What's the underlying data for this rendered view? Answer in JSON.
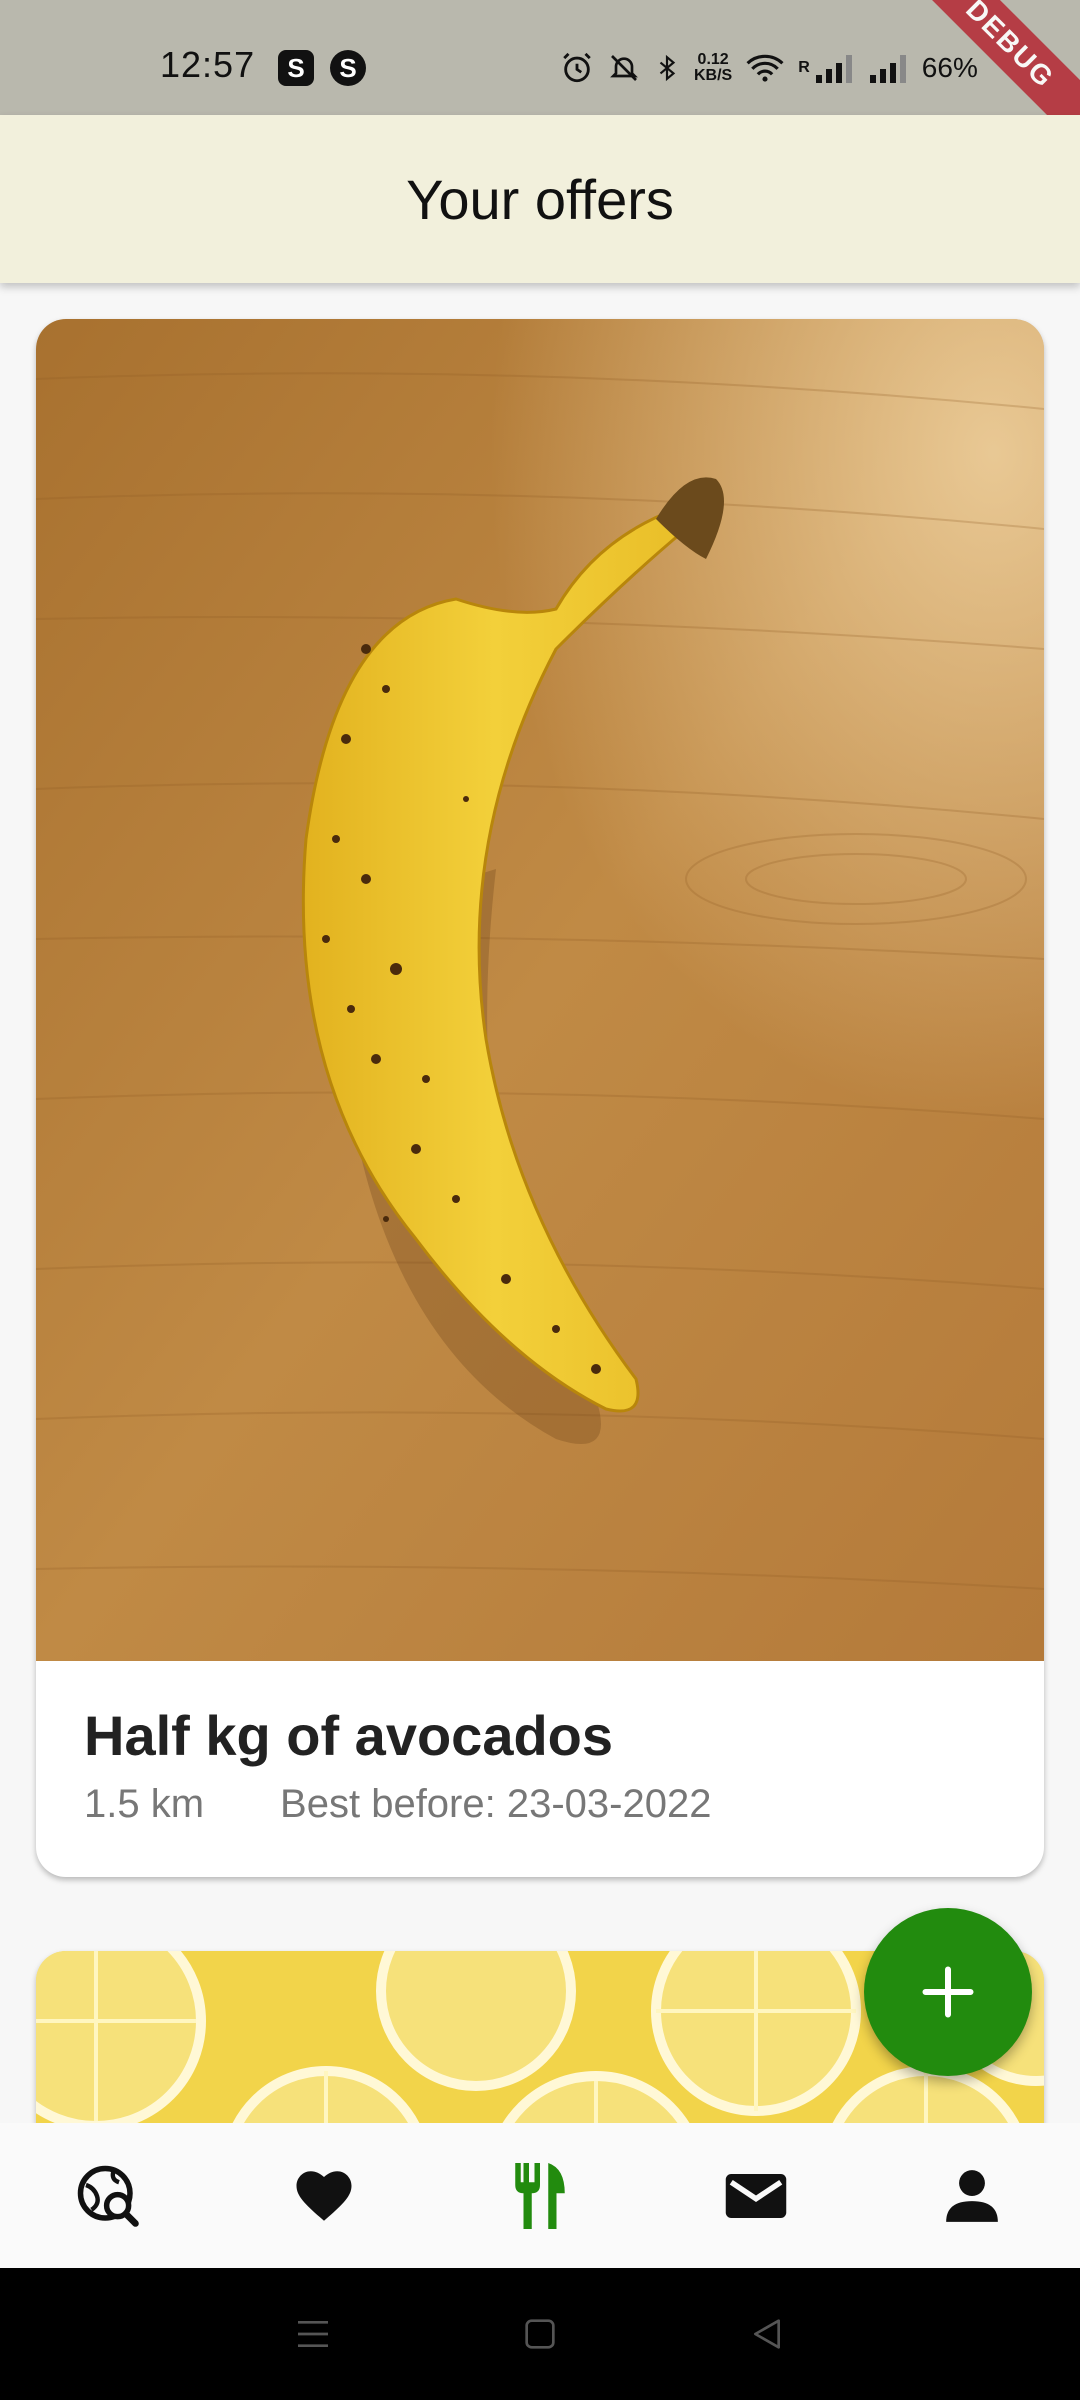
{
  "status_bar": {
    "time": "12:57",
    "app_badge_1": "S",
    "app_badge_2": "S",
    "net_speed_value": "0.12",
    "net_speed_unit": "KB/S",
    "roaming": "R",
    "battery": "66%",
    "debug_label": "DEBUG"
  },
  "app_bar": {
    "title": "Your offers"
  },
  "offers": [
    {
      "title": "Half kg of avocados",
      "distance": "1.5 km",
      "best_before": "Best before: 23-03-2022",
      "image_icon": "banana-photo"
    },
    {
      "image_icon": "lemons-photo"
    }
  ],
  "fab": {
    "label": "+",
    "icon": "add-icon"
  },
  "bottom_nav": {
    "items": [
      {
        "icon": "search-location-icon",
        "active": false
      },
      {
        "icon": "heart-icon",
        "active": false
      },
      {
        "icon": "fork-knife-icon",
        "active": true
      },
      {
        "icon": "mail-icon",
        "active": false
      },
      {
        "icon": "person-icon",
        "active": false
      }
    ],
    "active_color": "#228b0e",
    "inactive_color": "#111111"
  },
  "system_nav": {
    "items": [
      "recents-icon",
      "home-icon",
      "back-icon"
    ]
  }
}
